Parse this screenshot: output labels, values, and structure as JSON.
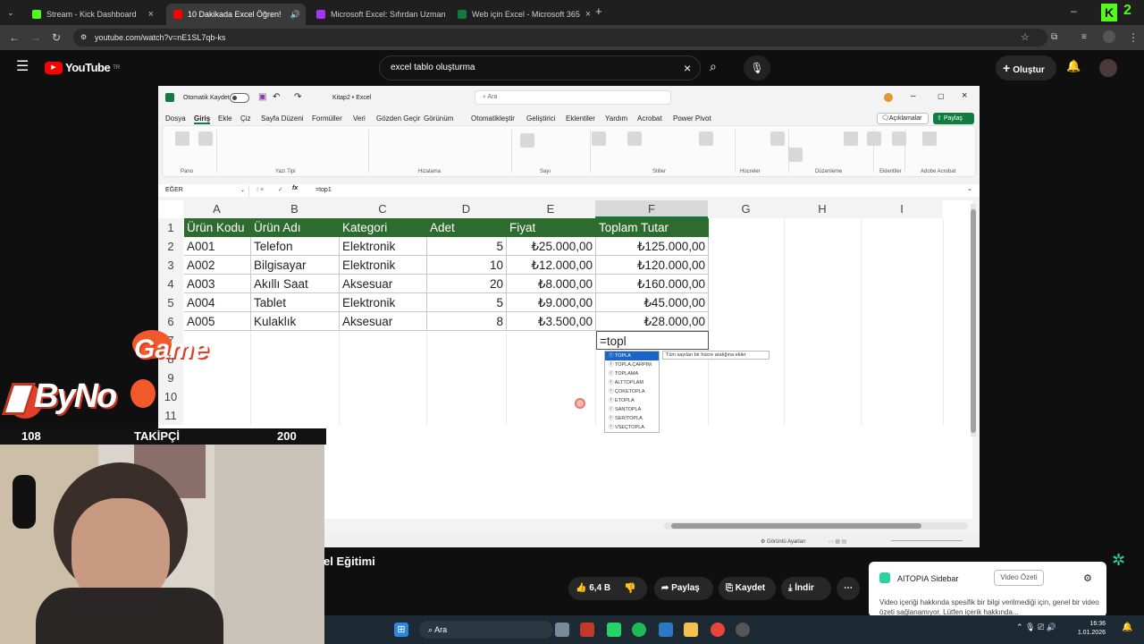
{
  "browser": {
    "tabs": [
      {
        "label": "Stream - Kick Dashboard",
        "color": "#53fc18"
      },
      {
        "label": "10 Dakikada Excel Öğren!",
        "color": "#ff0000"
      },
      {
        "label": "Microsoft Excel: Sıfırdan Uzman",
        "color": "#a435f0"
      },
      {
        "label": "Web için Excel - Microsoft 365",
        "color": "#107c41"
      }
    ],
    "url": "youtube.com/watch?v=nE1SL7qb-ks"
  },
  "youtube": {
    "logo": "YouTube",
    "logo_sup": "TR",
    "search_value": "excel tablo oluşturma",
    "create_label": "Oluştur",
    "video_title_partial": "el Eğitimi",
    "like_count": "6,4 B",
    "share_label": "Paylaş",
    "save_label": "Kaydet",
    "download_label": "İndir"
  },
  "excel": {
    "autosave_label": "Otomatik Kaydet",
    "filename": "Kitap2",
    "appname": "Excel",
    "search_placeholder": "Ara",
    "comments_label": "Açıklamalar",
    "share_label": "Paylaş",
    "menu": [
      "Dosya",
      "Giriş",
      "Ekle",
      "Çiz",
      "Sayfa Düzeni",
      "Formüller",
      "Veri",
      "Gözden Geçir",
      "Görünüm",
      "Otomatikleştir",
      "Geliştirici",
      "Eklentiler",
      "Yardım",
      "Acrobat",
      "Power Pivot"
    ],
    "ribbon_groups": [
      "Pano",
      "Yazı Tipi",
      "Hizalama",
      "Sayı",
      "Stiller",
      "Hücreler",
      "Düzenleme",
      "Eklentiler",
      "Adobe Acrobat"
    ],
    "name_box": "EĞER",
    "formula": "=top1",
    "columns": [
      "A",
      "B",
      "C",
      "D",
      "E",
      "F",
      "G",
      "H",
      "I"
    ],
    "rows": [
      "1",
      "2",
      "3",
      "4",
      "5",
      "6",
      "7",
      "8",
      "9",
      "10",
      "11"
    ],
    "headers": [
      "Ürün Kodu",
      "Ürün Adı",
      "Kategori",
      "Adet",
      "Fiyat",
      "Toplam Tutar"
    ],
    "data": [
      [
        "A001",
        "Telefon",
        "Elektronik",
        "5",
        "₺25.000,00",
        "₺125.000,00"
      ],
      [
        "A002",
        "Bilgisayar",
        "Elektronik",
        "10",
        "₺12.000,00",
        "₺120.000,00"
      ],
      [
        "A003",
        "Akıllı Saat",
        "Aksesuar",
        "20",
        "₺8.000,00",
        "₺160.000,00"
      ],
      [
        "A004",
        "Tablet",
        "Elektronik",
        "5",
        "₺9.000,00",
        "₺45.000,00"
      ],
      [
        "A005",
        "Kulaklık",
        "Aksesuar",
        "8",
        "₺3.500,00",
        "₺28.000,00"
      ]
    ],
    "editing_cell": "=topl",
    "autocomplete": [
      "TOPLA",
      "TOPLA.ÇARPIM",
      "TOPLAMA",
      "ALTTOPLAM",
      "ÇOKETOPLA",
      "ETOPLA",
      "SANTOPLA",
      "SERİTOPLA",
      "VSEÇTOPLA"
    ],
    "tooltip": "Tüm sayıları bir hücre aralığına ekler",
    "view_settings": "Görüntü Ayarları"
  },
  "overlay": {
    "brand_game": "Game",
    "brand_byno": "ByNo",
    "follower_current": "108",
    "follower_label": "TAKİPÇİ",
    "follower_goal": "200"
  },
  "aitopia": {
    "title": "AITOPIA Sidebar",
    "summary_btn": "Video Özeti",
    "body": "Video içeriği hakkında spesifik bir bilgi verilmediği için, genel bir video özeti sağlanamıyor. Lütfen içerik hakkında..."
  },
  "taskbar": {
    "search_placeholder": "Ara",
    "time": "16:36",
    "date": "1.01.2026"
  }
}
